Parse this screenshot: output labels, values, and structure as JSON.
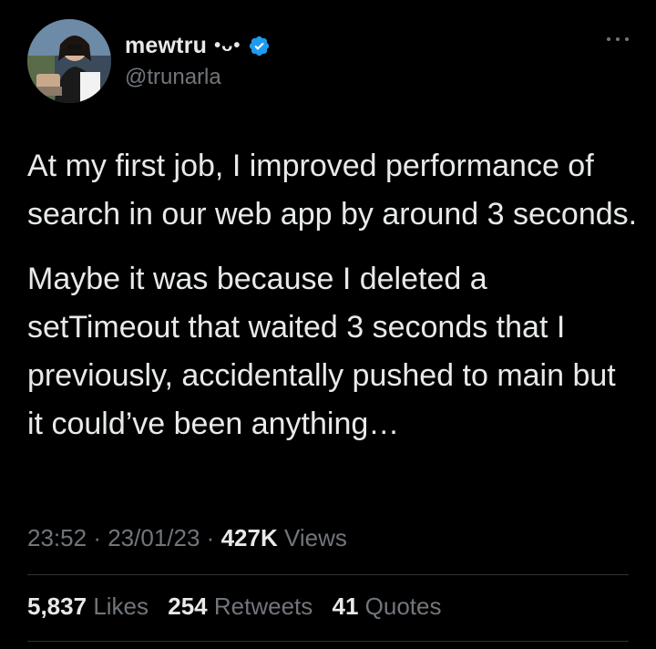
{
  "tweet": {
    "author": {
      "display_name": "mewtru",
      "emoji": "•ᴗ•",
      "handle": "@trunarla",
      "verified": true
    },
    "paragraphs": [
      "At my first job, I improved performance of search in our web app by around 3 seconds.",
      "Maybe it was because I deleted a setTimeout that waited 3 seconds that I previously, accidentally pushed to main but it could’ve been anything…"
    ],
    "meta": {
      "time": "23:52",
      "separator": "·",
      "date": "23/01/23",
      "views_count": "427K",
      "views_label": "Views"
    },
    "stats": {
      "likes_count": "5,837",
      "likes_label": "Likes",
      "retweets_count": "254",
      "retweets_label": "Retweets",
      "quotes_count": "41",
      "quotes_label": "Quotes"
    }
  },
  "colors": {
    "background": "#000000",
    "text_primary": "#e7e9ea",
    "text_secondary": "#71767b",
    "verified_blue": "#1d9bf0",
    "divider": "#2f3336"
  },
  "icons": {
    "verified": "verified-badge-icon",
    "more": "more-horizontal-icon"
  }
}
